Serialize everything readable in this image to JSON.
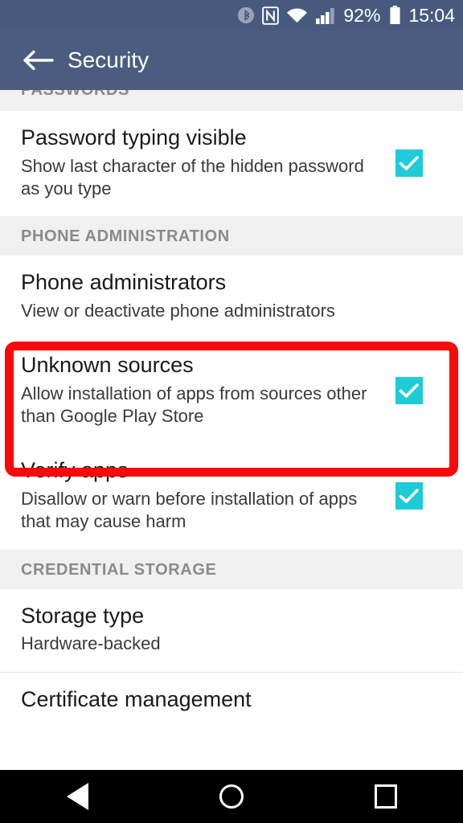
{
  "status_bar": {
    "bluetooth_icon": "bluetooth-icon",
    "nfc_icon": "nfc-icon",
    "wifi_icon": "wifi-icon",
    "signal_icon": "cellular-signal-icon",
    "battery_percent": "92%",
    "battery_icon": "battery-icon",
    "time": "15:04"
  },
  "toolbar": {
    "back_icon": "back-arrow-icon",
    "title": "Security"
  },
  "colors": {
    "toolbar": "#4a5d80",
    "statusbar": "#475a7d",
    "checkbox_accent": "#1ecbd7",
    "highlight": "#f60a0a",
    "section_header_bg": "#f0f0f0",
    "section_header_text": "#8a8a8a"
  },
  "sections": [
    {
      "header": "PASSWORDS",
      "clipped": true,
      "rows": [
        {
          "title": "Password typing visible",
          "subtitle": "Show last character of the hidden password as you type",
          "checkbox": true,
          "checked": true
        }
      ]
    },
    {
      "header": "PHONE ADMINISTRATION",
      "clipped": false,
      "rows": [
        {
          "title": "Phone administrators",
          "subtitle": "View or deactivate phone administrators",
          "checkbox": false,
          "checked": false
        },
        {
          "title": "Unknown sources",
          "subtitle": "Allow installation of apps from sources other than Google Play Store",
          "checkbox": true,
          "checked": true,
          "highlighted": true
        },
        {
          "title": "Verify apps",
          "subtitle": "Disallow or warn before installation of apps that may cause harm",
          "checkbox": true,
          "checked": true
        }
      ]
    },
    {
      "header": "CREDENTIAL STORAGE",
      "clipped": false,
      "rows": [
        {
          "title": "Storage type",
          "subtitle": "Hardware-backed",
          "checkbox": false,
          "checked": false
        },
        {
          "title": "Certificate management",
          "subtitle": "",
          "checkbox": false,
          "checked": false
        }
      ]
    }
  ],
  "navbar": {
    "back_label": "Back",
    "home_label": "Home",
    "recents_label": "Recent apps"
  }
}
